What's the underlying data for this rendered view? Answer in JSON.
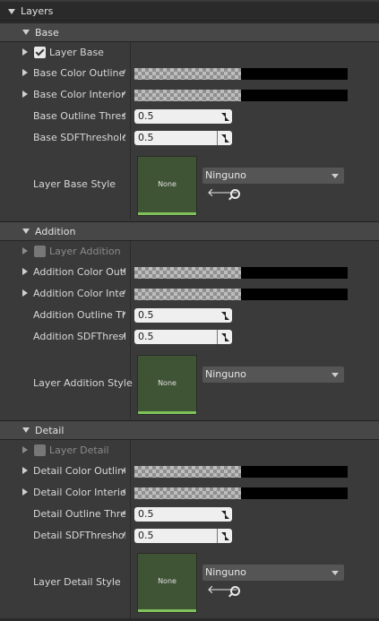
{
  "header": {
    "title": "Layers"
  },
  "sections": {
    "base": {
      "title": "Base",
      "enable": {
        "label": "Layer Base",
        "checked": true
      },
      "color_outline": {
        "label": "Base Color Outline"
      },
      "color_interior": {
        "label": "Base Color Interior"
      },
      "outline_threshold": {
        "label": "Base Outline Threshold",
        "value": "0.5"
      },
      "sdf_threshold": {
        "label": "Base SDFThreshold",
        "value": "0.5"
      },
      "style": {
        "label": "Layer Base Style",
        "thumb_text": "None",
        "dropdown": "Ninguno"
      }
    },
    "addition": {
      "title": "Addition",
      "enable": {
        "label": "Layer Addition",
        "checked": false
      },
      "color_outline": {
        "label": "Addition Color Outline"
      },
      "color_interior": {
        "label": "Addition Color Interior"
      },
      "outline_threshold": {
        "label": "Addition Outline Threshold",
        "value": "0.5"
      },
      "sdf_threshold": {
        "label": "Addition SDFThreshold",
        "value": "0.5"
      },
      "style": {
        "label": "Layer Addition Style",
        "thumb_text": "None",
        "dropdown": "Ninguno"
      }
    },
    "detail": {
      "title": "Detail",
      "enable": {
        "label": "Layer Detail",
        "checked": false
      },
      "color_outline": {
        "label": "Detail Color Outline"
      },
      "color_interior": {
        "label": "Detail Color Interior"
      },
      "outline_threshold": {
        "label": "Detail Outline Threshold",
        "value": "0.5"
      },
      "sdf_threshold": {
        "label": "Detail SDFThreshold",
        "value": "0.5"
      },
      "style": {
        "label": "Layer Detail Style",
        "thumb_text": "None",
        "dropdown": "Ninguno"
      }
    }
  },
  "colors": {
    "accent_bar": "#7fc25a",
    "thumb_bg": "#3f5335"
  },
  "icons": {
    "reset": "reset-arrow-icon",
    "browse": "left-arrow-icon",
    "search": "search-icon"
  }
}
